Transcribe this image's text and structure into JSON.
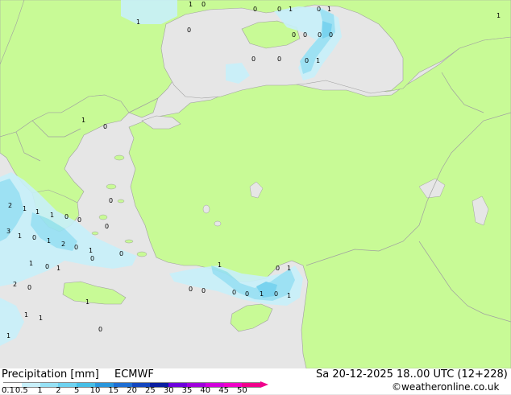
{
  "footer": {
    "title": "Precipitation [mm]",
    "model": "ECMWF",
    "datetime": "Sa 20-12-2025 18..00 UTC (12+228)",
    "credit": "©weatheronline.co.uk"
  },
  "colorbar": {
    "labels": [
      "0.1",
      "0.5",
      "1",
      "2",
      "5",
      "10",
      "15",
      "20",
      "25",
      "30",
      "35",
      "40",
      "45",
      "50"
    ],
    "colors": [
      "#ffffff",
      "#c8f0fa",
      "#96e1f5",
      "#6ed2f0",
      "#46bee6",
      "#2896dc",
      "#1e6ed2",
      "#1446be",
      "#0a1ea0",
      "#6e00dc",
      "#a000dc",
      "#d200dc",
      "#f000c8",
      "#f0008c"
    ]
  },
  "colors": {
    "sea": "#e6e6e6",
    "land": "#c8fa96",
    "border": "#a0a0a0",
    "precip_light": "#c8f0fa",
    "precip_medium": "#96e1f5",
    "precip_strong": "#6ed2f0"
  },
  "map_values": [
    "1",
    "0",
    "0",
    "0",
    "1",
    "0",
    "1",
    "1",
    "0",
    "1",
    "0",
    "0",
    "0",
    "0",
    "0",
    "0",
    "0",
    "1",
    "1",
    "0",
    "0",
    "2",
    "1",
    "1",
    "1",
    "0",
    "3",
    "1",
    "0",
    "1",
    "0",
    "2",
    "0",
    "1",
    "0",
    "0",
    "1",
    "0",
    "1",
    "0",
    "1",
    "2",
    "0",
    "0",
    "0",
    "0",
    "0",
    "1",
    "0",
    "1",
    "0",
    "1",
    "1",
    "1",
    "1",
    "0",
    "1",
    "1"
  ]
}
